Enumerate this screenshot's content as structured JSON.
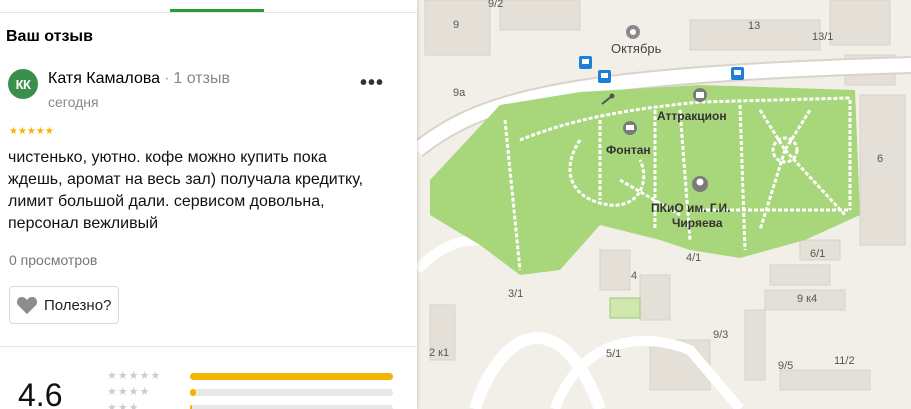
{
  "panel": {
    "section_title": "Ваш отзыв",
    "review": {
      "avatar_initials": "КК",
      "author": "Катя Камалова",
      "separator": "·",
      "reviews_count": "1 отзыв",
      "date": "сегодня",
      "more_label": "•••",
      "stars": "★★★★★",
      "rating": 5,
      "text": "чистенько, уютно. кофе можно купить пока ждешь, аромат на весь зал) получала кредитку, лимит большой дали. сервисом довольна, персонал вежливый",
      "views": "0 просмотров",
      "useful_label": "Полезно?"
    },
    "summary": {
      "rating": "4.6",
      "rows": [
        {
          "stars": "★★★★★",
          "fraction": 1.0
        },
        {
          "stars": "★★★★",
          "fraction": 0.03
        },
        {
          "stars": "★★★",
          "fraction": 0.01
        }
      ]
    },
    "colors": {
      "accent": "#2d9b3a",
      "star": "#f5b400",
      "avatar": "#3a8f4d"
    }
  },
  "map": {
    "labels": {
      "l9": "9",
      "l92": "9/2",
      "l13": "13",
      "l131": "13/1",
      "oktyabr": "Октябрь",
      "l9a": "9а",
      "attraction": "Аттракцион",
      "fontan": "Фонтан",
      "park1": "ПКиО им. Г.И.",
      "park2": "Чиряева",
      "l6": "6",
      "l4": "4",
      "l41": "4/1",
      "l61": "6/1",
      "l31": "3/1",
      "l9k4": "9 к4",
      "l93": "9/3",
      "l2k1": "2 к1",
      "l51": "5/1",
      "l95": "9/5",
      "l112": "11/2"
    },
    "colors": {
      "park": "#a8d67a",
      "road": "#ffffff",
      "bus": "#1e7fd6"
    }
  }
}
